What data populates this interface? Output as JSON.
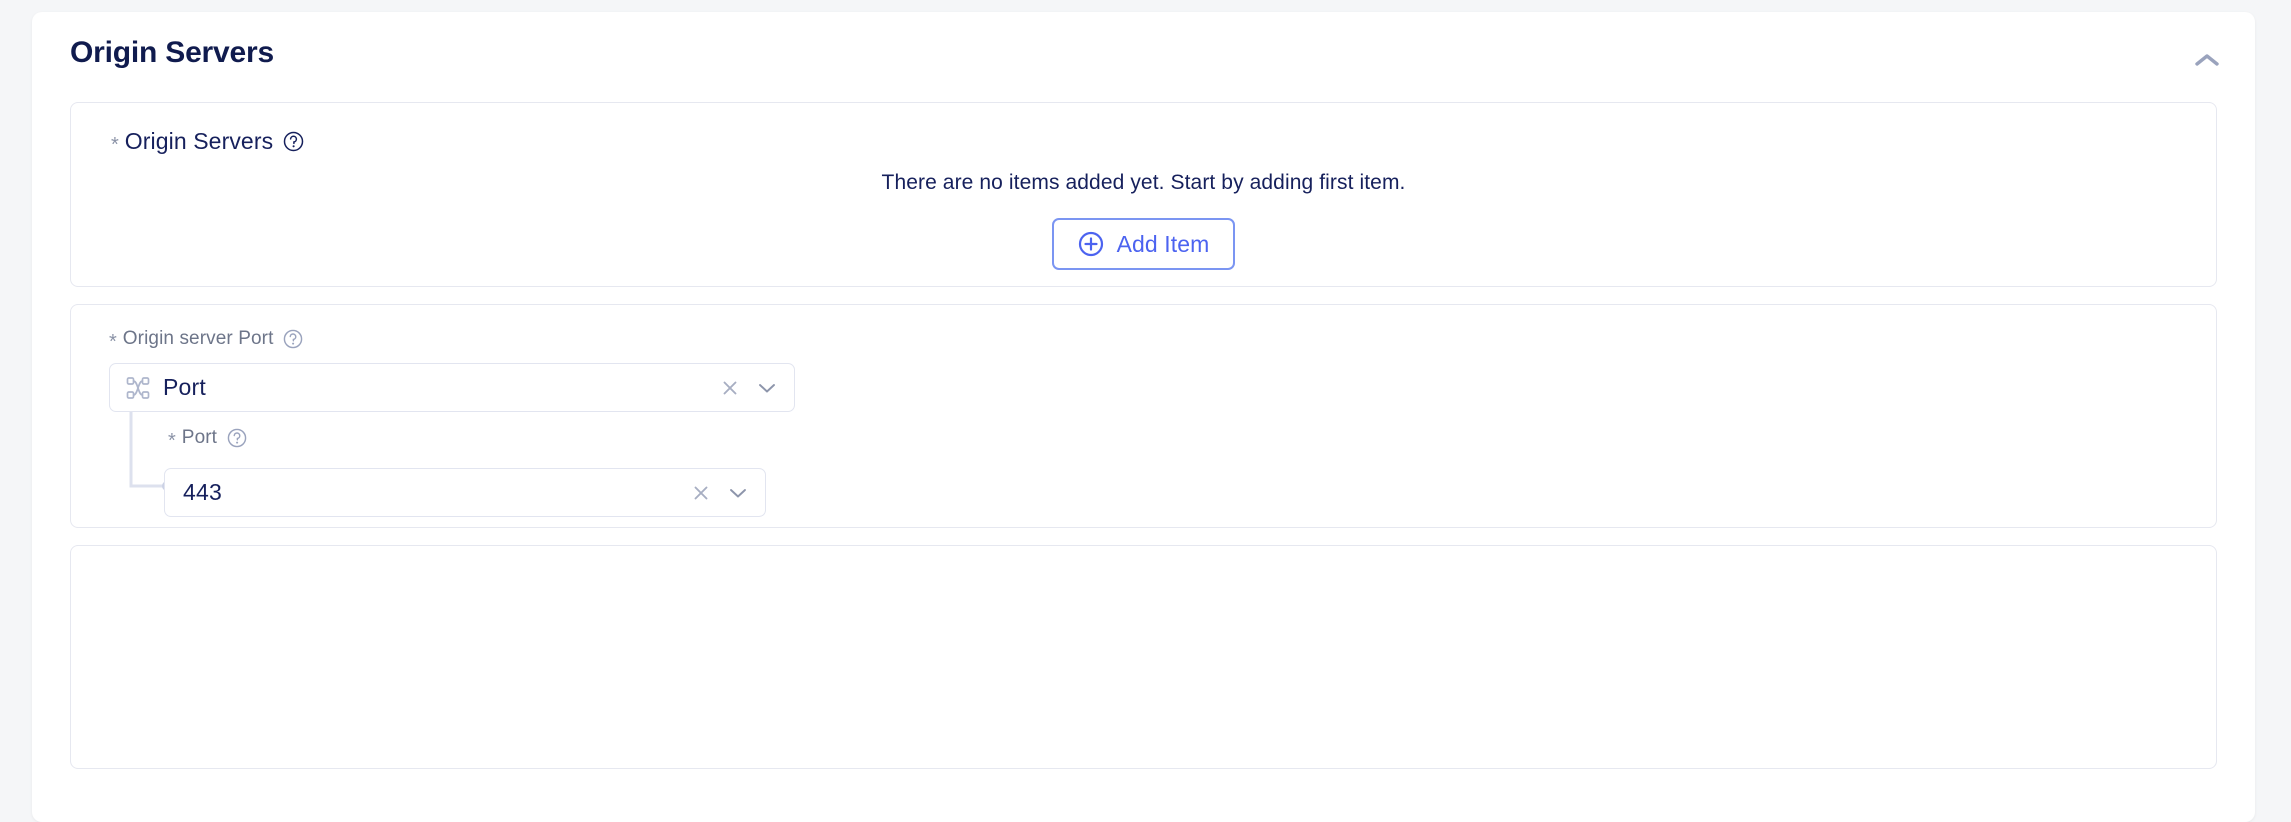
{
  "section": {
    "title": "Origin Servers",
    "collapse_icon": "chevron-up-icon"
  },
  "origin_servers_field": {
    "required_marker": "*",
    "label": "Origin Servers",
    "help_icon": "question-circle-icon",
    "empty_message": "There are no items added yet. Start by adding first item.",
    "add_button_label": "Add Item",
    "add_button_icon": "plus-circle-icon",
    "highlight_color": "#ec1c24"
  },
  "origin_server_port_field": {
    "required_marker": "*",
    "label": "Origin server Port",
    "help_icon": "question-circle-icon",
    "select_value": "Port",
    "select_lead_icon": "shuffle-nodes-icon",
    "clear_icon": "clear-x-icon",
    "chevron_icon": "chevron-down-icon"
  },
  "port_subfield": {
    "required_marker": "*",
    "label": "Port",
    "help_icon": "question-circle-icon",
    "value": "443",
    "clear_icon": "clear-x-icon",
    "chevron_icon": "chevron-down-icon"
  },
  "colors": {
    "title": "#101b4e",
    "accent_blue": "#4c63f0",
    "button_border": "#7b95f2",
    "panel_border": "#e6e8f0",
    "label_gray": "#6d7589",
    "page_background": "#f5f6f8"
  }
}
